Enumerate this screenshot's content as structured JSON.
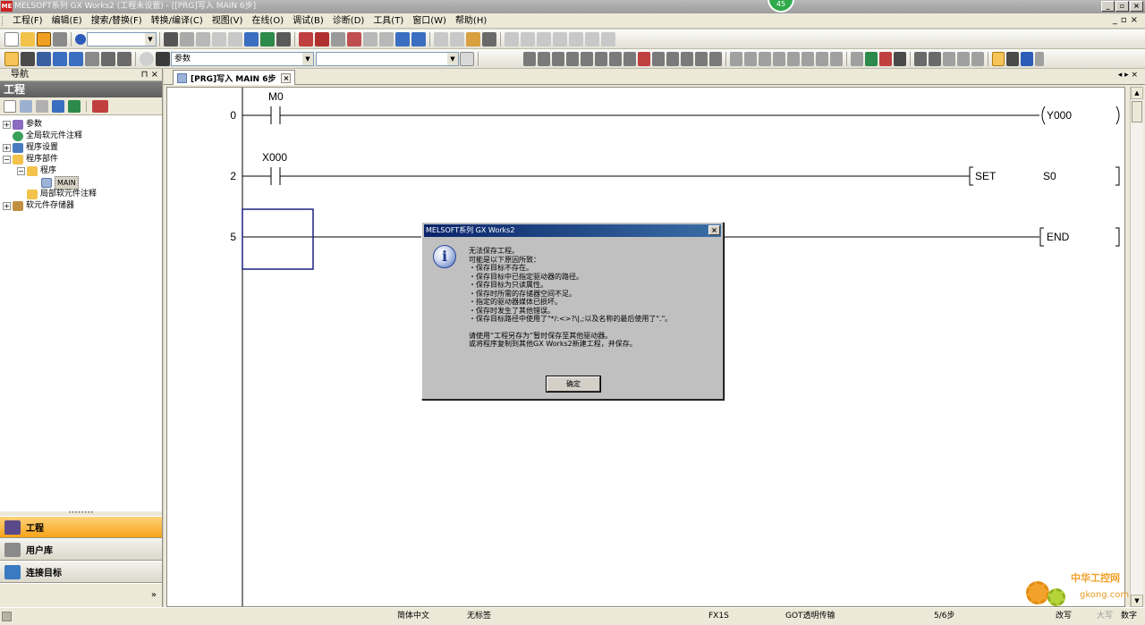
{
  "window": {
    "title": "MELSOFT系列 GX Works2 (工程未设置) - [[PRG]写入 MAIN 6步]",
    "badge": "45",
    "controls": [
      "_",
      "▫",
      "×"
    ]
  },
  "menu": {
    "items": [
      "工程(F)",
      "编辑(E)",
      "搜索/替换(F)",
      "转换/编译(C)",
      "视图(V)",
      "在线(O)",
      "调试(B)",
      "诊断(D)",
      "工具(T)",
      "窗口(W)",
      "帮助(H)"
    ],
    "mdi_controls": [
      "_",
      "▫",
      "×"
    ]
  },
  "toolbar": {
    "combo1_value": "",
    "combo2_value": "参数",
    "combo3_value": ""
  },
  "navigation": {
    "header_title": "导航",
    "header_controls": "⊓ ×",
    "section_title": "工程",
    "tree": [
      {
        "label": "参数",
        "toggle": "+"
      },
      {
        "label": "全局软元件注释",
        "toggle": ""
      },
      {
        "label": "程序设置",
        "toggle": "+"
      },
      {
        "label": "程序部件",
        "toggle": "−"
      },
      {
        "label": "程序",
        "toggle": "−"
      },
      {
        "label": "MAIN",
        "toggle": ""
      },
      {
        "label": "局部软元件注释",
        "toggle": ""
      },
      {
        "label": "软元件存储器",
        "toggle": "+"
      }
    ],
    "tabs": [
      {
        "label": "工程",
        "active": true
      },
      {
        "label": "用户库",
        "active": false
      },
      {
        "label": "连接目标",
        "active": false
      }
    ],
    "more_chevron": "»"
  },
  "document": {
    "tab_label": "[PRG]写入 MAIN 6步",
    "tab_close": "×",
    "tab_nav": "◂ ▸ ×"
  },
  "ladder": {
    "rungs": [
      {
        "step": "0",
        "contact": "M0",
        "output": "Y000",
        "output_type": "coil"
      },
      {
        "step": "2",
        "contact": "X000",
        "output": "SET",
        "operand": "S0",
        "output_type": "instruction"
      },
      {
        "step": "5",
        "contact": "",
        "output": "END",
        "output_type": "instruction"
      }
    ]
  },
  "dialog": {
    "title": "MELSOFT系列 GX Works2",
    "close": "×",
    "lines": [
      "无法保存工程。",
      "可能是以下原因所致：",
      "・保存目标不存在。",
      "・保存目标中已指定驱动器的路径。",
      "・保存目标为只读属性。",
      "・保存时所需的存储器空间不足。",
      "・指定的驱动器媒体已损坏。",
      "・保存时发生了其他错误。",
      "・保存目标路径中使用了\"*/:<>?\\|,;以及名称的最后使用了\".\"。",
      "",
      "请使用“工程另存为”暂时保存至其他驱动器。",
      "或将程序复制到其他GX Works2新建工程，并保存。"
    ],
    "ok_label": "确定"
  },
  "statusbar": {
    "language": "简体中文",
    "label_setting": "无标签",
    "plc_type": "FX1S",
    "transfer": "GOT透明传输",
    "steps": "5/6步",
    "mode": "改写",
    "caps": "大写",
    "num": "数字"
  },
  "watermark": {
    "cn": "中华工控网",
    "en": "gkong.com"
  }
}
